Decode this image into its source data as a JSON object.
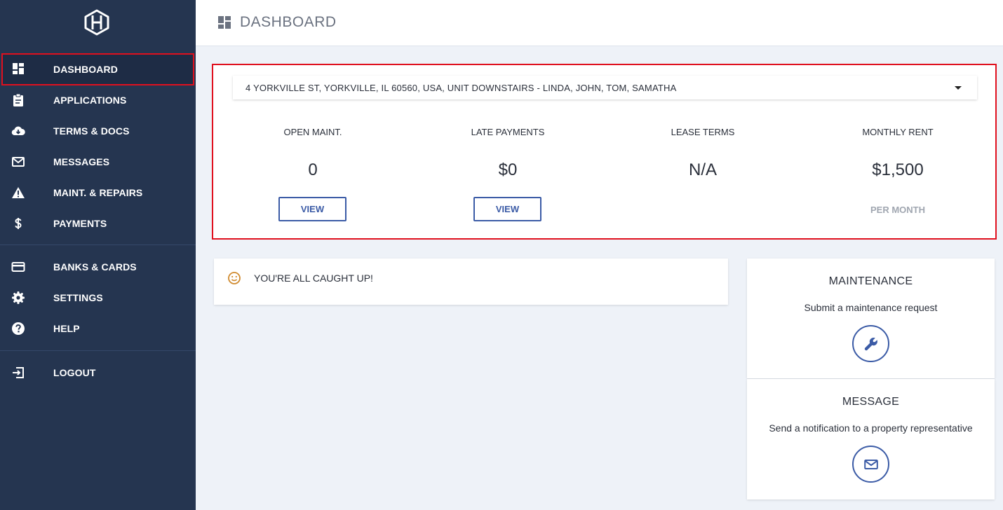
{
  "sidebar": {
    "items": [
      {
        "label": "DASHBOARD",
        "icon": "dashboard-icon"
      },
      {
        "label": "APPLICATIONS",
        "icon": "clipboard-icon"
      },
      {
        "label": "TERMS & DOCS",
        "icon": "cloud-download-icon"
      },
      {
        "label": "MESSAGES",
        "icon": "envelope-icon"
      },
      {
        "label": "MAINT. & REPAIRS",
        "icon": "warning-icon"
      },
      {
        "label": "PAYMENTS",
        "icon": "dollar-icon"
      },
      {
        "label": "BANKS & CARDS",
        "icon": "credit-card-icon"
      },
      {
        "label": "SETTINGS",
        "icon": "gear-icon"
      },
      {
        "label": "HELP",
        "icon": "help-icon"
      },
      {
        "label": "LOGOUT",
        "icon": "logout-icon"
      }
    ]
  },
  "header": {
    "title": "DASHBOARD"
  },
  "property": {
    "selected": "4 YORKVILLE ST, YORKVILLE, IL 60560, USA, UNIT DOWNSTAIRS - LINDA, JOHN, TOM, SAMATHA"
  },
  "stats": [
    {
      "label": "OPEN MAINT.",
      "value": "0",
      "action": "VIEW"
    },
    {
      "label": "LATE PAYMENTS",
      "value": "$0",
      "action": "VIEW"
    },
    {
      "label": "LEASE TERMS",
      "value": "N/A"
    },
    {
      "label": "MONTHLY RENT",
      "value": "$1,500",
      "note": "PER MONTH"
    }
  ],
  "notice": {
    "text": "YOU'RE ALL CAUGHT UP!"
  },
  "cards": [
    {
      "title": "MAINTENANCE",
      "subtitle": "Submit a maintenance request",
      "icon": "wrench-icon"
    },
    {
      "title": "MESSAGE",
      "subtitle": "Send a notification to a property representative",
      "icon": "envelope-icon"
    }
  ],
  "colors": {
    "sidebar": "#253550",
    "accent": "#3b5ba6",
    "highlight": "#e0101e",
    "background": "#eef2f8"
  }
}
